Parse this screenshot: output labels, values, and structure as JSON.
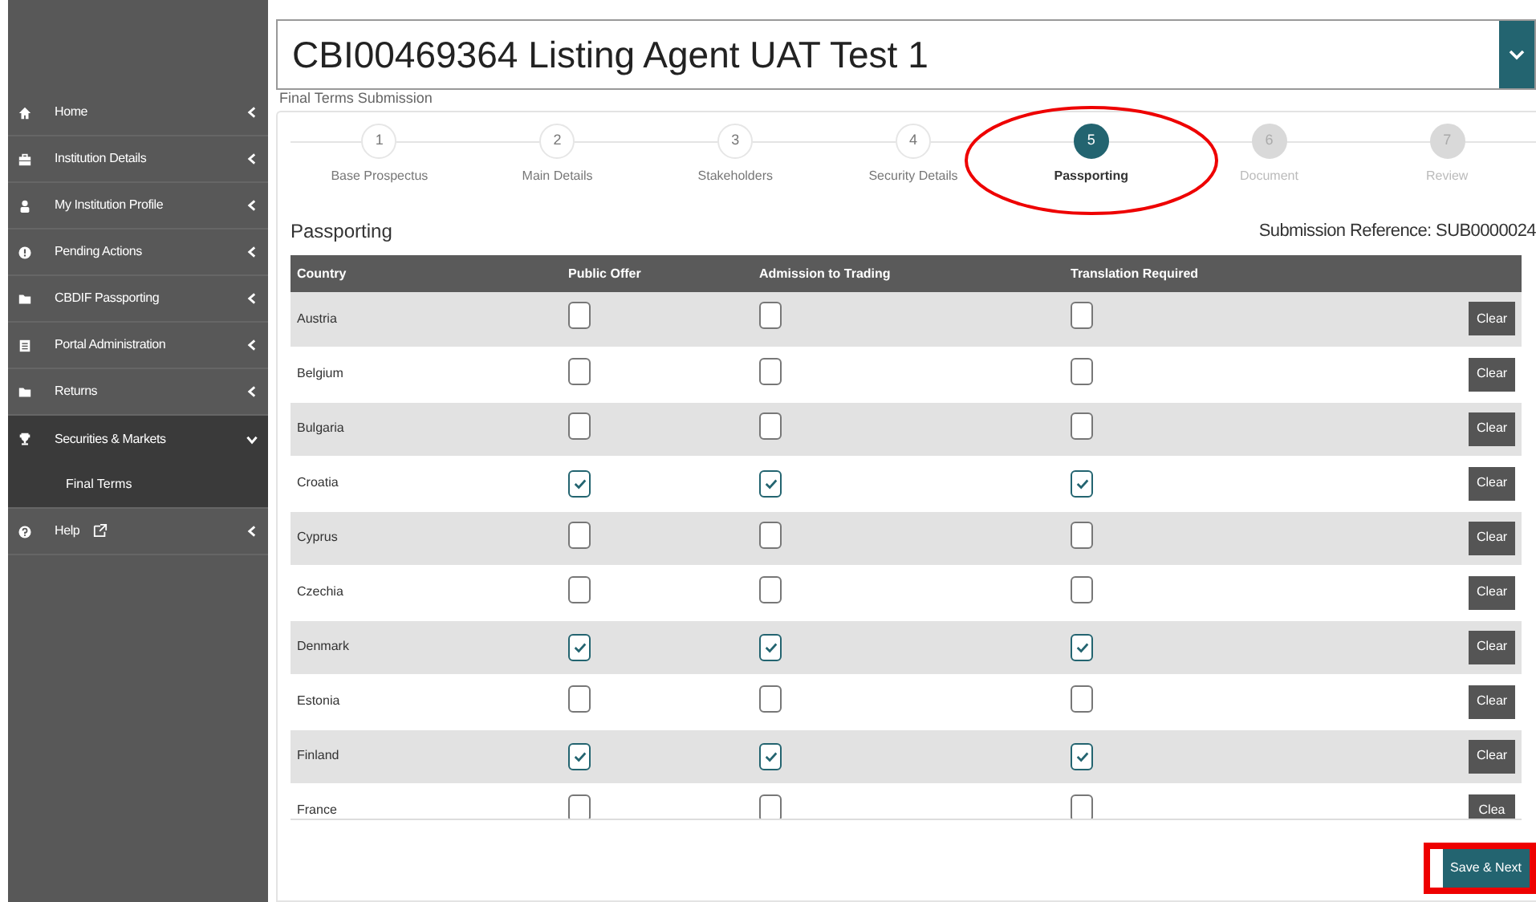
{
  "sidebar": {
    "items": [
      {
        "label": "Home",
        "expanded": false
      },
      {
        "label": "Institution Details",
        "expanded": false
      },
      {
        "label": "My Institution Profile",
        "expanded": false
      },
      {
        "label": "Pending Actions",
        "expanded": false
      },
      {
        "label": "CBDIF Passporting",
        "expanded": false
      },
      {
        "label": "Portal Administration",
        "expanded": false
      },
      {
        "label": "Returns",
        "expanded": false
      },
      {
        "label": "Securities & Markets",
        "expanded": true,
        "children": [
          {
            "label": "Final Terms"
          }
        ]
      },
      {
        "label": "Help",
        "external": true,
        "expanded": false
      }
    ]
  },
  "header": {
    "title": "CBI00469364 Listing Agent UAT Test 1",
    "subtitle": "Final Terms Submission"
  },
  "steps": [
    {
      "number": "1",
      "label": "Base Prospectus",
      "selected": false,
      "disabled": false
    },
    {
      "number": "2",
      "label": "Main Details",
      "selected": false,
      "disabled": false
    },
    {
      "number": "3",
      "label": "Stakeholders",
      "selected": false,
      "disabled": false
    },
    {
      "number": "4",
      "label": "Security Details",
      "selected": false,
      "disabled": false
    },
    {
      "number": "5",
      "label": "Passporting",
      "selected": true,
      "disabled": false
    },
    {
      "number": "6",
      "label": "Document",
      "selected": false,
      "disabled": true
    },
    {
      "number": "7",
      "label": "Review",
      "selected": false,
      "disabled": true
    }
  ],
  "section": {
    "title": "Passporting",
    "reference": "Submission Reference: SUB0000024"
  },
  "table": {
    "columns": [
      "Country",
      "Public Offer",
      "Admission to Trading",
      "Translation Required"
    ],
    "rows": [
      {
        "country": "Austria",
        "public_offer": false,
        "admission": false,
        "translation": false,
        "action": "Clear"
      },
      {
        "country": "Belgium",
        "public_offer": false,
        "admission": false,
        "translation": false,
        "action": "Clear"
      },
      {
        "country": "Bulgaria",
        "public_offer": false,
        "admission": false,
        "translation": false,
        "action": "Clear"
      },
      {
        "country": "Croatia",
        "public_offer": true,
        "admission": true,
        "translation": true,
        "action": "Clear"
      },
      {
        "country": "Cyprus",
        "public_offer": false,
        "admission": false,
        "translation": false,
        "action": "Clear"
      },
      {
        "country": "Czechia",
        "public_offer": false,
        "admission": false,
        "translation": false,
        "action": "Clear"
      },
      {
        "country": "Denmark",
        "public_offer": true,
        "admission": true,
        "translation": true,
        "action": "Clear"
      },
      {
        "country": "Estonia",
        "public_offer": false,
        "admission": false,
        "translation": false,
        "action": "Clear"
      },
      {
        "country": "Finland",
        "public_offer": true,
        "admission": true,
        "translation": true,
        "action": "Clear"
      },
      {
        "country": "France",
        "public_offer": false,
        "admission": false,
        "translation": false,
        "action": "Clea"
      }
    ]
  },
  "save_button": "Save & Next"
}
